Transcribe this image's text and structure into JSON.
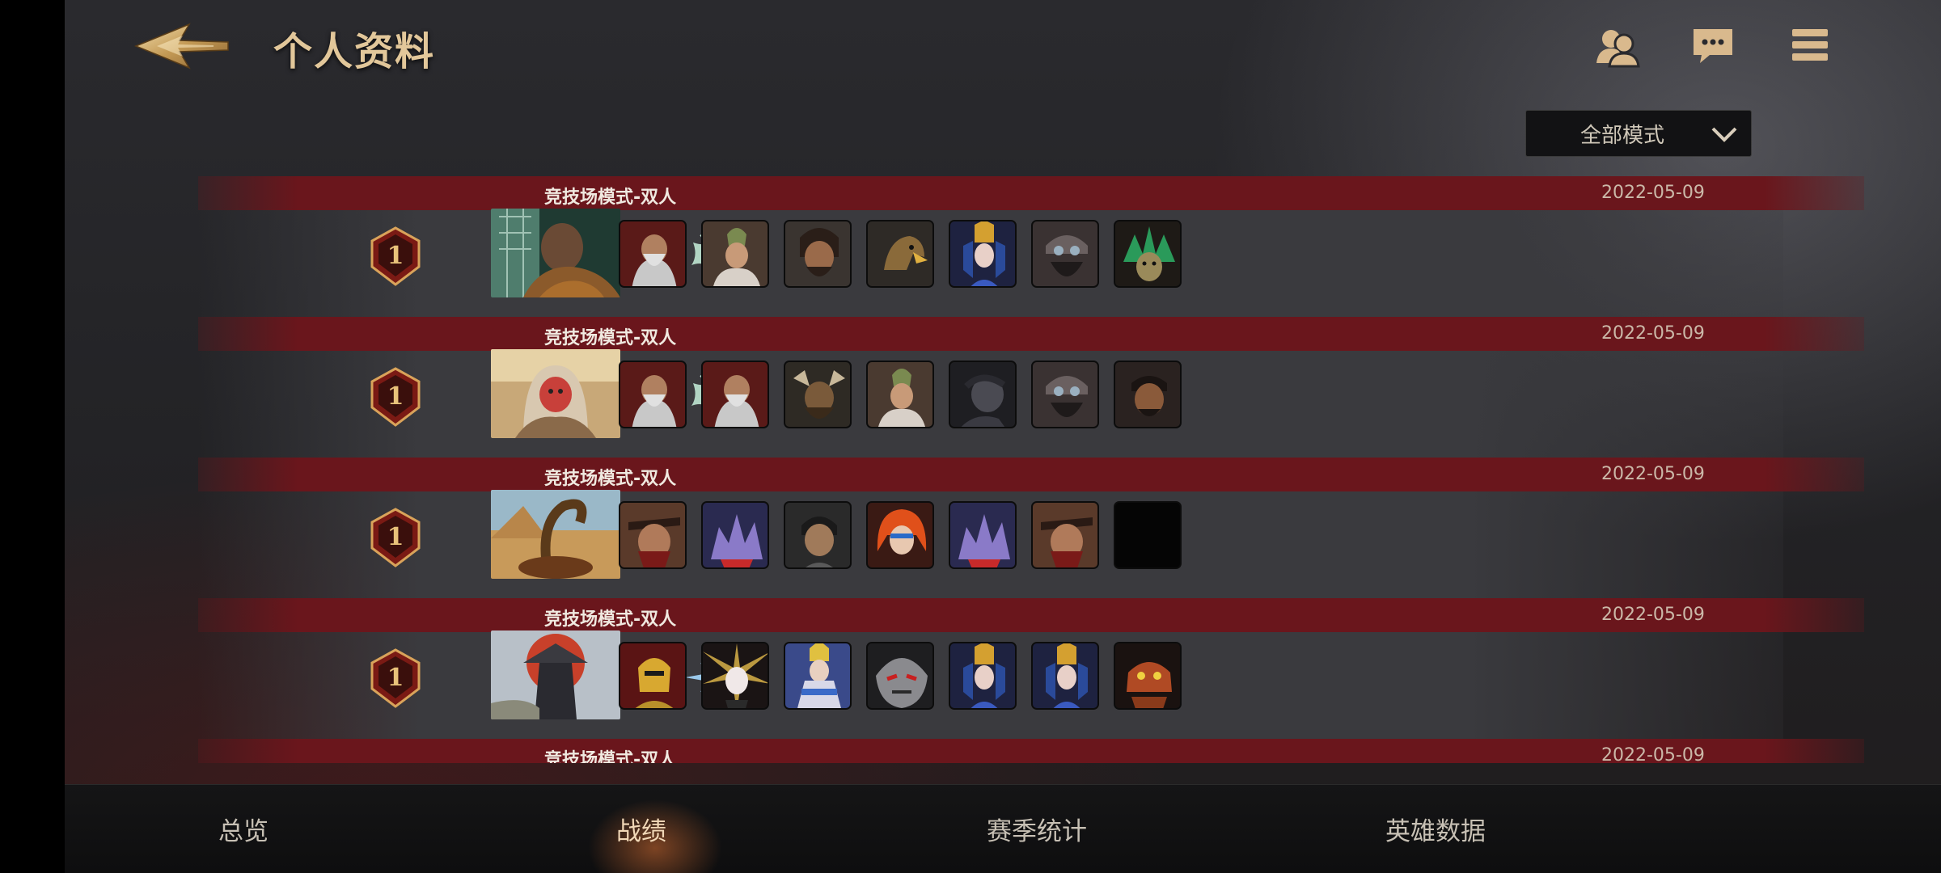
{
  "header": {
    "title": "个人资料"
  },
  "mode_filter": {
    "selected": "全部模式"
  },
  "matches": [
    {
      "mode": "竞技场模式-双人",
      "date": "2022-05-09",
      "placement": "1",
      "faction": "winged-crest-icon",
      "heroes": [
        "armored-bearded-warrior",
        "old-sage",
        "bearded-barbarian",
        "eagle",
        "azure-queen",
        "goggled-dwarf",
        "green-frilled-beast"
      ]
    },
    {
      "mode": "竞技场模式-双人",
      "date": "2022-05-09",
      "placement": "1",
      "faction": "winged-crest-icon",
      "heroes": [
        "armored-bearded-warrior",
        "armored-bearded-warrior",
        "horned-warlord",
        "old-sage",
        "dark-spirit",
        "goggled-dwarf",
        "scarred-brute"
      ]
    },
    {
      "mode": "竞技场模式-双人",
      "date": "2022-05-09",
      "placement": "1",
      "faction": "shadow-claw-icon",
      "heroes": [
        "masked-ronin",
        "crystal-golem",
        "grey-warrior",
        "red-haired-huntress",
        "crystal-golem",
        "masked-ronin",
        "empty-slot"
      ]
    },
    {
      "mode": "竞技场模式-双人",
      "date": "2022-05-09",
      "placement": "1",
      "faction": "star-burst-icon",
      "heroes": [
        "golden-paladin",
        "sun-priestess",
        "celestial-mage",
        "silver-beast",
        "azure-queen",
        "azure-queen",
        "red-goblin"
      ]
    },
    {
      "mode": "竞技场模式-双人",
      "date": "2022-05-09"
    }
  ],
  "bottom_nav": {
    "tabs": [
      "总览",
      "战绩",
      "赛季统计",
      "英雄数据"
    ],
    "active": "战绩"
  }
}
